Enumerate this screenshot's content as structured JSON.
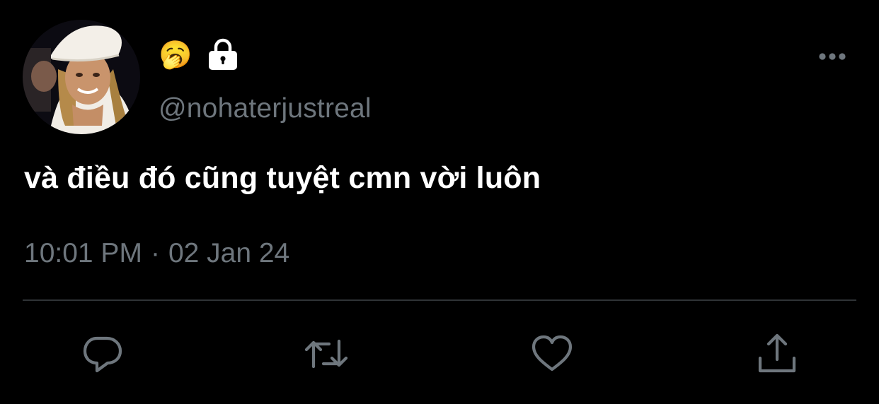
{
  "tweet": {
    "display_name_emoji": "🥱",
    "lock_icon": "lock-icon",
    "handle": "@nohaterjustreal",
    "text": "và điều đó cũng tuyệt cmn vời luôn",
    "time": "10:01 PM",
    "separator": "·",
    "date": "02 Jan 24"
  },
  "actions": {
    "reply_icon": "reply-icon",
    "retweet_icon": "retweet-icon",
    "like_icon": "heart-icon",
    "share_icon": "share-icon",
    "more_icon": "more-icon"
  },
  "colors": {
    "background": "#000000",
    "primary_text": "#ffffff",
    "secondary_text": "#6e767d",
    "divider": "#2f3336",
    "icon": "#6e767d"
  }
}
